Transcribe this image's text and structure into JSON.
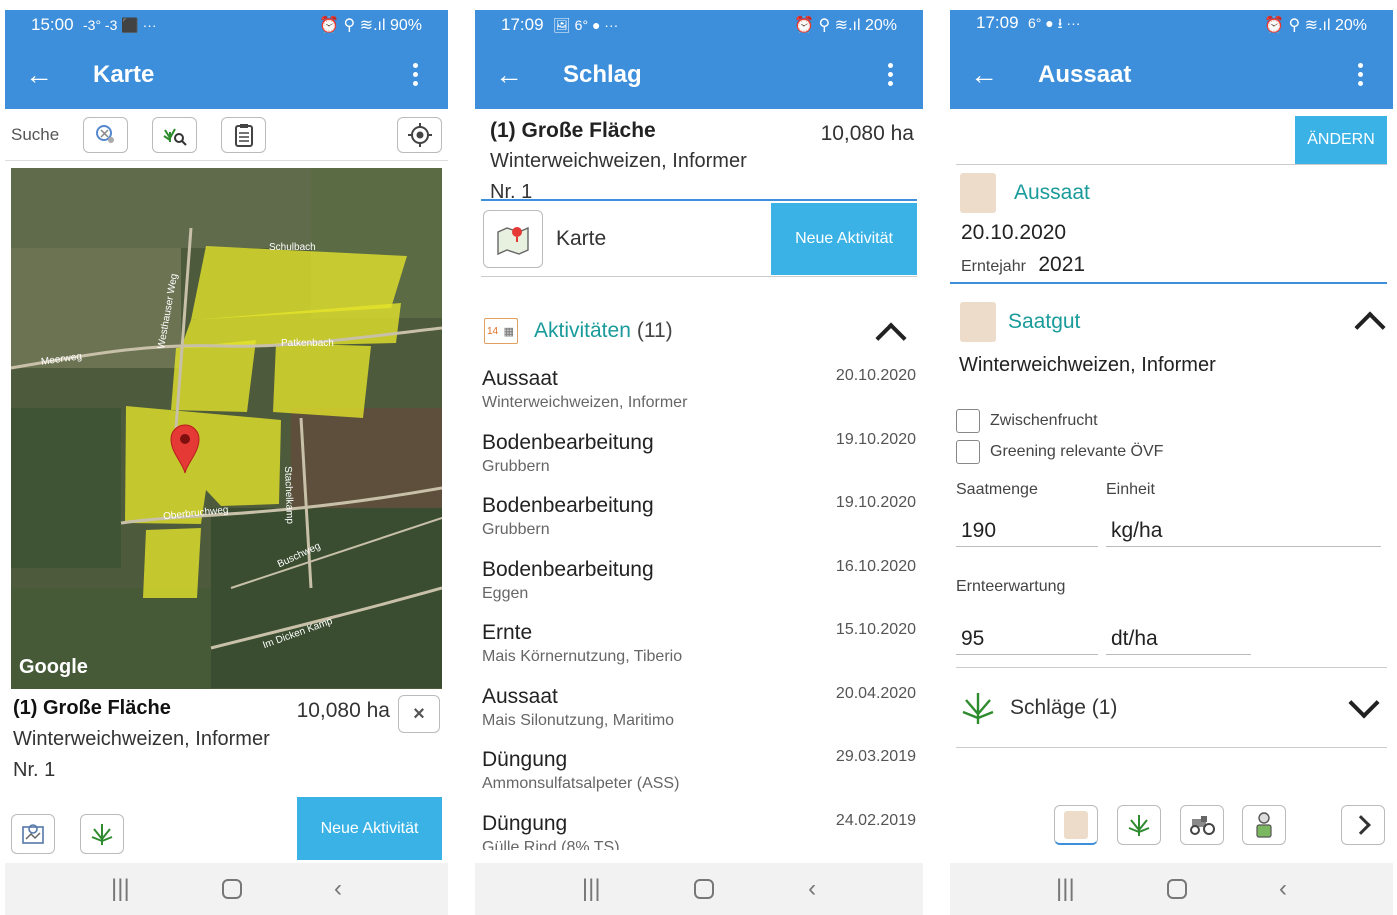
{
  "panel1": {
    "status": {
      "time": "15:00",
      "left_icons": "-3° -3 ⬛ ···",
      "right": "⏰ ⚲ ≋.ıl 90%"
    },
    "appbar": {
      "title": "Karte"
    },
    "search_label": "Suche",
    "map": {
      "google_label": "Google",
      "roads": [
        "Schulbach",
        "Westhauser Weg",
        "Meerweg",
        "Patkenbach",
        "Oberbruchweg",
        "Stachelkamp",
        "Buschweg",
        "Im Dicken Kamp"
      ]
    },
    "field": {
      "name": "(1) Große Fläche",
      "area": "10,080 ha",
      "crop": "Winterweichweizen, Informer",
      "nr": "Nr. 1",
      "close": "×"
    },
    "new_activity": "Neue Aktivität"
  },
  "panel2": {
    "status": {
      "time": "17:09",
      "left_icons": "🖼 6° ● ···",
      "right": "⏰ ⚲ ≋.ıl 20%"
    },
    "appbar": {
      "title": "Schlag"
    },
    "field": {
      "name": "(1) Große Fläche",
      "area": "10,080 ha",
      "crop": "Winterweichweizen, Informer",
      "nr": "Nr. 1"
    },
    "map_label": "Karte",
    "new_activity": "Neue Aktivität",
    "activities_title": "Aktivitäten",
    "activities_count": "(11)",
    "calendar_day": "14",
    "activities": [
      {
        "title": "Aussaat",
        "sub": "Winterweichweizen, Informer",
        "date": "20.10.2020"
      },
      {
        "title": "Bodenbearbeitung",
        "sub": "Grubbern",
        "date": "19.10.2020"
      },
      {
        "title": "Bodenbearbeitung",
        "sub": "Grubbern",
        "date": "19.10.2020"
      },
      {
        "title": "Bodenbearbeitung",
        "sub": "Eggen",
        "date": "16.10.2020"
      },
      {
        "title": "Ernte",
        "sub": "Mais Körnernutzung, Tiberio",
        "date": "15.10.2020"
      },
      {
        "title": "Aussaat",
        "sub": "Mais Silonutzung, Maritimo",
        "date": "20.04.2020"
      },
      {
        "title": "Düngung",
        "sub": "Ammonsulfatsalpeter (ASS)",
        "date": "29.03.2019"
      },
      {
        "title": "Düngung",
        "sub": "Gülle Rind (8% TS)",
        "date": "24.02.2019"
      }
    ]
  },
  "panel3": {
    "status": {
      "time": "17:09",
      "left_icons": "6° ● ⭳ ···",
      "right": "⏰ ⚲ ≋.ıl 20%"
    },
    "appbar": {
      "title": "Aussaat"
    },
    "edit_button": "ÄNDERN",
    "aussaat": {
      "title": "Aussaat",
      "date": "20.10.2020",
      "harvest_year_label": "Erntejahr",
      "harvest_year": "2021"
    },
    "saatgut": {
      "title": "Saatgut",
      "crop": "Winterweichweizen, Informer"
    },
    "checkbox_zwischenfrucht": "Zwischenfrucht",
    "checkbox_greening": "Greening relevante ÖVF",
    "saatmenge_label": "Saatmenge",
    "einheit_label": "Einheit",
    "saatmenge": "190",
    "einheit": "kg/ha",
    "ernteerwartung_label": "Ernteerwartung",
    "ernteerwartung": "95",
    "ernteerwartung_unit": "dt/ha",
    "schlaege": "Schläge (1)"
  }
}
